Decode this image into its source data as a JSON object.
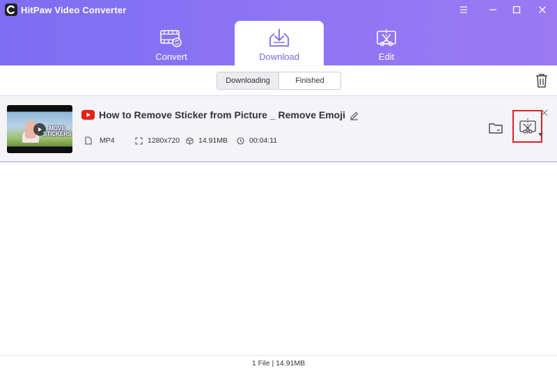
{
  "app": {
    "title": "HitPaw Video Converter"
  },
  "tabs": [
    {
      "label": "Convert",
      "icon": "film-convert-icon",
      "active": false
    },
    {
      "label": "Download",
      "icon": "download-icon",
      "active": true
    },
    {
      "label": "Edit",
      "icon": "scissors-edit-icon",
      "active": false
    }
  ],
  "segment": {
    "downloading_label": "Downloading",
    "finished_label": "Finished",
    "selected": "Finished"
  },
  "item": {
    "source_icon": "youtube-icon",
    "title": "How to Remove Sticker from Picture _ Remove Emoji",
    "thumbnail_caption": "MOVE STICKERS",
    "format": "MP4",
    "resolution": "1280x720",
    "size": "14.91MB",
    "duration": "00:04:11"
  },
  "footer": {
    "summary": "1 File | 14.91MB"
  },
  "colors": {
    "header_start": "#7d6df2",
    "header_end": "#9a79f3",
    "accent": "#7a67e6",
    "highlight": "#e02020",
    "youtube": "#e62117"
  }
}
